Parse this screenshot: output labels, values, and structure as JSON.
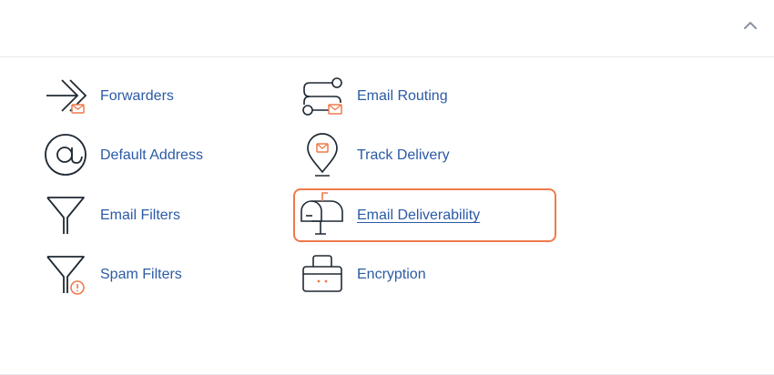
{
  "colors": {
    "link": "#2b5aa5",
    "icon_stroke": "#1f2933",
    "accent": "#ef7a4a"
  },
  "header": {
    "collapse_icon": "chevron-up-icon"
  },
  "items": [
    {
      "label": "Forwarders",
      "icon": "forwarders-icon"
    },
    {
      "label": "Default Address",
      "icon": "at-sign-icon"
    },
    {
      "label": "Email Filters",
      "icon": "funnel-icon"
    },
    {
      "label": "Spam Filters",
      "icon": "funnel-alert-icon"
    },
    {
      "label": "Email Routing",
      "icon": "routing-icon"
    },
    {
      "label": "Track Delivery",
      "icon": "map-pin-mail-icon"
    },
    {
      "label": "Email Deliverability",
      "icon": "mailbox-icon",
      "highlighted": true
    },
    {
      "label": "Encryption",
      "icon": "encryption-box-icon"
    }
  ]
}
